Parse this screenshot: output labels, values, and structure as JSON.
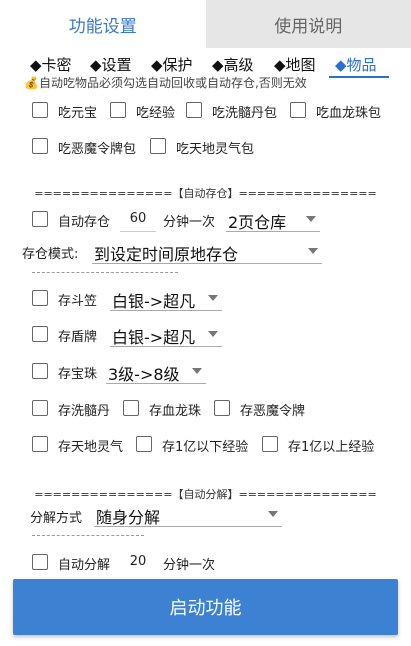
{
  "tabs": [
    {
      "label": "功能设置",
      "active": true
    },
    {
      "label": "使用说明",
      "active": false
    }
  ],
  "subtabs": [
    "◆卡密",
    "◆设置",
    "◆保护",
    "◆高级",
    "◆地图",
    "◆物品"
  ],
  "notice": "💰自动吃物品必须勾选自动回收或自动存仓,否则无效",
  "eat": {
    "items": [
      "吃元宝",
      "吃经验",
      "吃洗髓丹包",
      "吃血龙珠包",
      "吃恶魔令牌包",
      "吃天地灵气包"
    ]
  },
  "auto_store": {
    "header": "===============【自动存仓】===============",
    "checkbox_label": "自动存仓",
    "interval_value": "60",
    "interval_unit": "分钟一次",
    "storage_select": "2页仓库",
    "mode_label": "存仓模式:",
    "mode_select": "到设定时间原地存仓",
    "douli_label": "存斗笠",
    "douli_select": "白银->超凡",
    "shield_label": "存盾牌",
    "shield_select": "白银->超凡",
    "gem_label": "存宝珠",
    "gem_select": "3级->8级",
    "items_row1": [
      "存洗髓丹",
      "存血龙珠",
      "存恶魔令牌"
    ],
    "items_row2": [
      "存天地灵气",
      "存1亿以下经验",
      "存1亿以上经验"
    ]
  },
  "auto_decompose": {
    "header": "===============【自动分解】===============",
    "method_label": "分解方式",
    "method_select": "随身分解",
    "checkbox_label": "自动分解",
    "interval_value": "20",
    "interval_unit": "分钟一次"
  },
  "start_button": "启动功能",
  "colors": {
    "accent": "#3d82d2",
    "tab_active_text": "#3a78c9",
    "tab_inactive_bg": "#e6e6e6"
  }
}
